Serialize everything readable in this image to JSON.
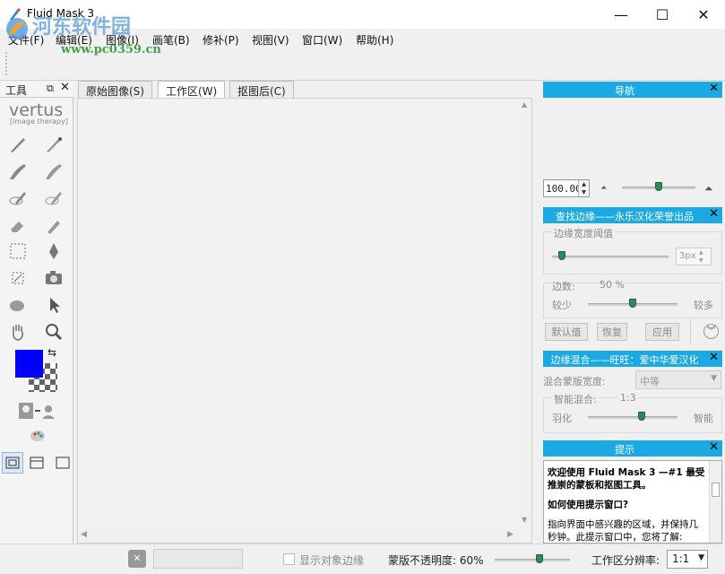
{
  "window": {
    "title": "Fluid Mask 3",
    "min": "—",
    "max": "☐",
    "close": "✕"
  },
  "watermark": {
    "brand": "河东软件园",
    "url": "www.pc0359.cn"
  },
  "menu": [
    "文件(F)",
    "编辑(E)",
    "图像(I)",
    "画笔(B)",
    "修补(P)",
    "视图(V)",
    "窗口(W)",
    "帮助(H)"
  ],
  "tools": {
    "title": "工具",
    "logo_name": "vertus",
    "logo_sub": "[image therapy]",
    "primary_color": "#0000ff"
  },
  "tabs": [
    "原始图像(S)",
    "工作区(W)",
    "抠图后(C)"
  ],
  "active_tab": 1,
  "navigator": {
    "title": "导航",
    "zoom_value": "100.00",
    "zoom_level": 0.5
  },
  "edge_panel": {
    "title": "查找边缘——永乐汉化荣誉出品",
    "width_label": "边缘宽度阈值",
    "width_value": "3px",
    "count_label": "边数:",
    "count_value": "50 %",
    "less": "较少",
    "more": "较多",
    "count_level": 0.5,
    "btn_default": "默认值",
    "btn_restore": "恢复",
    "btn_apply": "应用"
  },
  "blend_panel": {
    "title": "边缘混合——旺旺：爱中华爱汉化",
    "width_label": "混合蒙版宽度:",
    "width_value": "中等",
    "smart_label": "智能混合:",
    "smart_value": "1:3",
    "feather": "羽化",
    "smart": "智能",
    "smart_level": 0.6
  },
  "tips_panel": {
    "title": "提示",
    "line1": "欢迎使用 Fluid Mask 3 —#1 最受推崇的蒙板和抠图工具。",
    "line2": "如何使用提示窗口?",
    "line3": "指向界面中感兴趣的区域，并保持几秒钟。此提示窗口中，您将了解:"
  },
  "status": {
    "show_edges": "显示对象边缘",
    "opacity_label": "蒙版不透明度: 60%",
    "opacity_level": 0.6,
    "resolution_label": "工作区分辨率:",
    "resolution_value": "1:1"
  },
  "colors": {
    "accent": "#1aa9e3",
    "fg_color": "#0000ff"
  }
}
